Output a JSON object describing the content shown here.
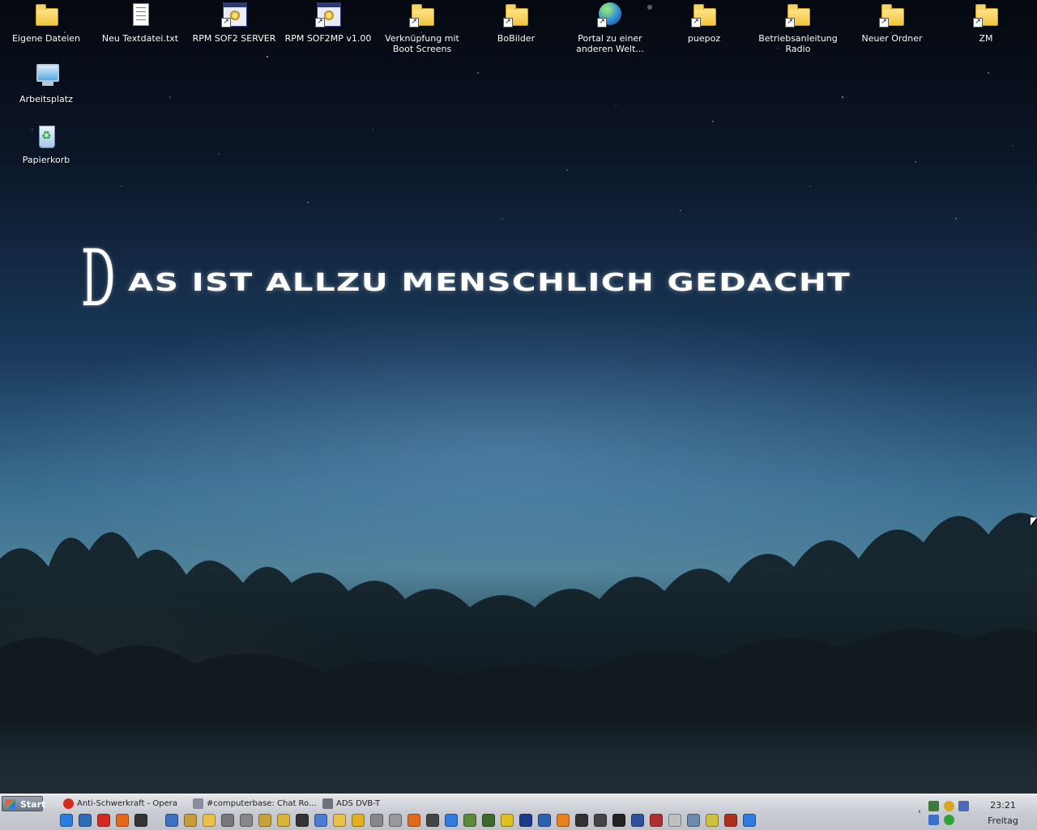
{
  "desktop": {
    "wallpaper_text_first": "D",
    "wallpaper_text_rest": "AS IST ALLZU MENSCHLICH GEDACHT",
    "icons": [
      {
        "label": "Eigene Dateien",
        "icon": "my-documents-icon"
      },
      {
        "label": "Neu Textdatei.txt",
        "icon": "text-file-icon"
      },
      {
        "label": "RPM SOF2 SERVER",
        "icon": "application-shortcut-icon"
      },
      {
        "label": "RPM SOF2MP v1.00",
        "icon": "application-shortcut-icon"
      },
      {
        "label": "Verknüpfung mit Boot Screens",
        "icon": "folder-shortcut-icon"
      },
      {
        "label": "BoBilder",
        "icon": "folder-shortcut-icon"
      },
      {
        "label": "Portal zu einer anderen Welt...",
        "icon": "globe-shortcut-icon"
      },
      {
        "label": "puepoz",
        "icon": "folder-shortcut-icon"
      },
      {
        "label": "Betriebsanleitung Radio",
        "icon": "folder-shortcut-icon"
      },
      {
        "label": "Neuer Ordner",
        "icon": "folder-shortcut-icon"
      },
      {
        "label": "ZM",
        "icon": "folder-shortcut-icon"
      },
      {
        "label": "Arbeitsplatz",
        "icon": "my-computer-icon"
      },
      {
        "label": "Papierkorb",
        "icon": "recycle-bin-icon"
      }
    ]
  },
  "taskbar": {
    "start_label": "Start",
    "tasks": [
      {
        "label": "Anti-Schwerkraft - Opera",
        "icon": "opera-icon",
        "color": "#d52a1e"
      },
      {
        "label": "#computerbase: Chat Ro...",
        "icon": "chat-icon",
        "color": "#8a8f99"
      },
      {
        "label": "ADS DVB-T",
        "icon": "tv-icon",
        "color": "#6e737a"
      }
    ],
    "quick_launch_colors": [
      "#2d7ce0",
      "#2f6db8",
      "#d52a1e",
      "#e36a1c",
      "#333333",
      "#3d6fc2",
      "#c89b3c",
      "#e8c04a",
      "#777777",
      "#888888",
      "#c8a13a",
      "#d9b33a",
      "#333333",
      "#4a7bd0",
      "#e8c04a",
      "#e0b020",
      "#888888",
      "#999999",
      "#e36a1c",
      "#444444",
      "#2d7ce0",
      "#5a8a3a",
      "#3a6a2a",
      "#e0c020",
      "#1e3a8a",
      "#2b5fb0",
      "#e8801c",
      "#333333",
      "#444444",
      "#222222",
      "#3050a0",
      "#b03030",
      "#c0c0c0",
      "#6a8ab0",
      "#d0c040",
      "#b03020",
      "#2d7ce0"
    ],
    "tray_icons": [
      "network-icon",
      "globe-icon",
      "monitor-icon",
      "volume-icon",
      "update-icon"
    ],
    "clock_time": "23:21",
    "clock_day": "Freitag"
  }
}
